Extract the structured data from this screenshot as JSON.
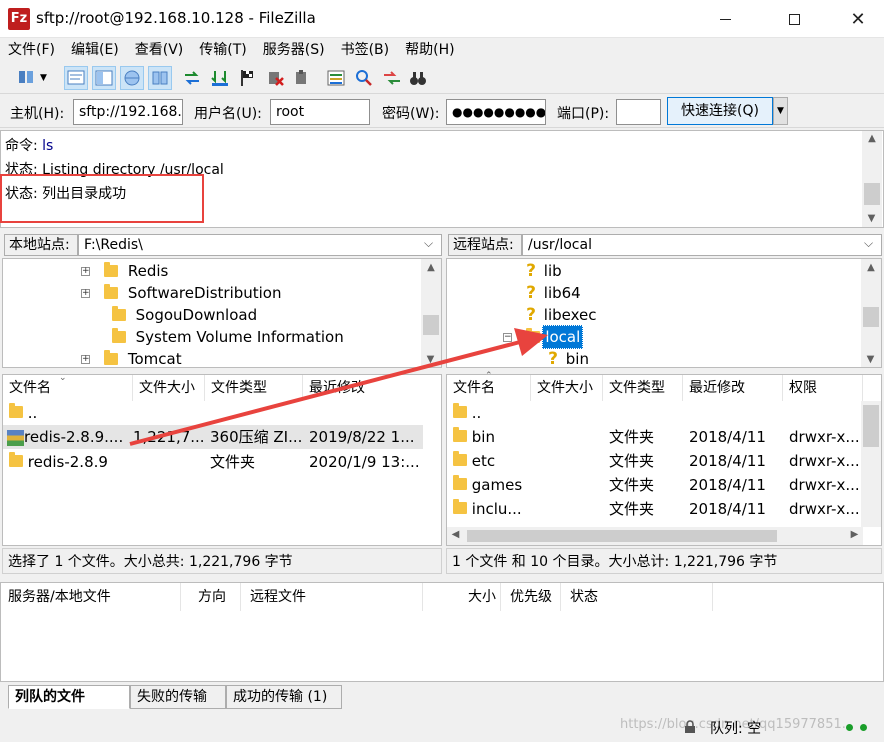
{
  "window": {
    "title": "sftp://root@192.168.10.128 - FileZilla",
    "app_icon": "Fz"
  },
  "menu": [
    "文件(F)",
    "编辑(E)",
    "查看(V)",
    "传输(T)",
    "服务器(S)",
    "书签(B)",
    "帮助(H)"
  ],
  "quickconnect": {
    "host_label": "主机(H):",
    "host_value": "sftp://192.168.",
    "user_label": "用户名(U):",
    "user_value": "root",
    "pass_label": "密码(W):",
    "pass_value": "●●●●●●●●●●",
    "port_label": "端口(P):",
    "port_value": "",
    "button": "快速连接(Q)"
  },
  "log": [
    {
      "label": "命令:",
      "text": "ls",
      "color": "#00008b"
    },
    {
      "label": "状态:",
      "text": "Listing directory /usr/local",
      "color": "#000000"
    },
    {
      "label": "状态:",
      "text": "列出目录成功",
      "color": "#000000"
    }
  ],
  "local": {
    "site_label": "本地站点:",
    "path": "F:\\Redis\\",
    "tree": [
      "Redis",
      "SoftwareDistribution",
      "SogouDownload",
      "System Volume Information",
      "Tomcat"
    ],
    "columns": [
      "文件名",
      "文件大小",
      "文件类型",
      "最近修改"
    ],
    "rows": [
      {
        "name": "..",
        "size": "",
        "type": "",
        "modified": ""
      },
      {
        "name": "redis-2.8.9....",
        "size": "1,221,7...",
        "type": "360压缩 ZI...",
        "modified": "2019/8/22 1..."
      },
      {
        "name": "redis-2.8.9",
        "size": "",
        "type": "文件夹",
        "modified": "2020/1/9 13:..."
      }
    ],
    "status": "选择了 1 个文件。大小总共: 1,221,796 字节"
  },
  "remote": {
    "site_label": "远程站点:",
    "path": "/usr/local",
    "tree": [
      "lib",
      "lib64",
      "libexec",
      "local",
      "bin"
    ],
    "columns": [
      "文件名",
      "文件大小",
      "文件类型",
      "最近修改",
      "权限"
    ],
    "rows": [
      {
        "name": "..",
        "size": "",
        "type": "",
        "modified": "",
        "perm": ""
      },
      {
        "name": "bin",
        "size": "",
        "type": "文件夹",
        "modified": "2018/4/11",
        "perm": "drwxr-x..."
      },
      {
        "name": "etc",
        "size": "",
        "type": "文件夹",
        "modified": "2018/4/11",
        "perm": "drwxr-x..."
      },
      {
        "name": "games",
        "size": "",
        "type": "文件夹",
        "modified": "2018/4/11",
        "perm": "drwxr-x..."
      },
      {
        "name": "inclu...",
        "size": "",
        "type": "文件夹",
        "modified": "2018/4/11",
        "perm": "drwxr-x..."
      }
    ],
    "status": "1 个文件 和 10 个目录。大小总计: 1,221,796 字节"
  },
  "queue": {
    "columns": [
      "服务器/本地文件",
      "方向",
      "远程文件",
      "大小",
      "优先级",
      "状态"
    ]
  },
  "tabs": [
    "列队的文件",
    "失败的传输",
    "成功的传输 (1)"
  ],
  "bottom": {
    "queue_label": "队列: 空",
    "watermark": "https://blog.csdn.net/qq15977851..."
  },
  "colors": {
    "annotation_red": "#e8433e",
    "selection_blue": "#0078d7"
  }
}
